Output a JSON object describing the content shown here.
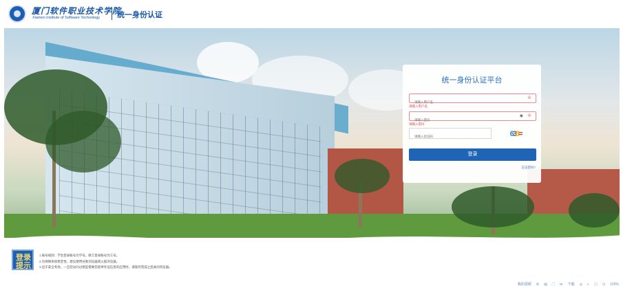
{
  "header": {
    "school_name_cn": "厦门软件职业技术学院",
    "school_name_en": "Xiamen Institute of Software Technology",
    "platform_title": "统一身份认证"
  },
  "login": {
    "title": "统一身份认证平台",
    "username_placeholder": "请输入用户名",
    "username_error": "请输入用户名",
    "password_placeholder": "请输入密码",
    "password_error": "请输入密码",
    "captcha_placeholder": "请输入验证码",
    "captcha_chars": [
      "6",
      "3",
      "6",
      "="
    ],
    "captcha_colors": [
      "#2b8ad6",
      "#5d5d5d",
      "#e8b021",
      "#c0392b"
    ],
    "submit_label": "登录",
    "forgot_label": "忘记密码?"
  },
  "notice": {
    "badge_top": "登录",
    "badge_bottom": "提示",
    "lines": [
      "1.账号规则：学生登录账号为学号，教工登录账号为工号。",
      "2.为保障系统稳定性，建议使用谷歌浏览器或火狐浏览器。",
      "3.出于安全考虑，一旦您访问过那些需要您提供凭证信息的应用时，请操作完成之后关闭浏览器。"
    ]
  },
  "status_bar": {
    "items": [
      "我的视频",
      "⚙",
      "▤",
      "⛶",
      "≫",
      "下载",
      "◎",
      "◐",
      "▢",
      "◷"
    ],
    "zoom": "100%"
  }
}
